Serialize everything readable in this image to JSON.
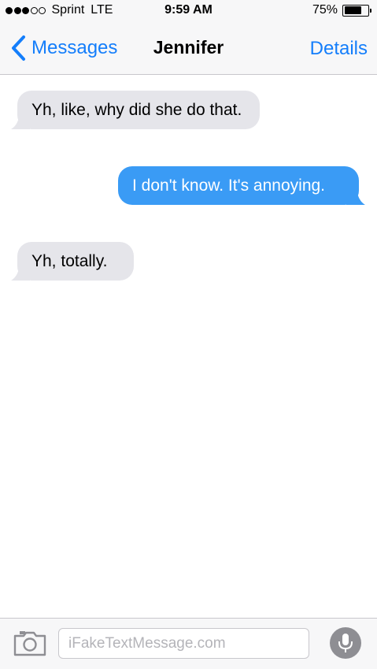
{
  "status_bar": {
    "signal_dots_filled": 3,
    "signal_dots_total": 5,
    "carrier": "Sprint",
    "network": "LTE",
    "time": "9:59 AM",
    "battery_percent": "75%",
    "battery_level": 0.75
  },
  "nav": {
    "back_label": "Messages",
    "title": "Jennifer",
    "details_label": "Details",
    "accent_color": "#147efb"
  },
  "messages": [
    {
      "direction": "incoming",
      "text": "Yh, like, why did she do that."
    },
    {
      "direction": "outgoing",
      "text": "I don't know. It's annoying."
    },
    {
      "direction": "incoming",
      "text": "Yh, totally."
    }
  ],
  "colors": {
    "incoming_bubble": "#e5e5ea",
    "outgoing_bubble": "#3a9bf5"
  },
  "input_bar": {
    "camera_icon": "camera-icon",
    "placeholder": "iFakeTextMessage.com",
    "mic_icon": "microphone-icon"
  }
}
